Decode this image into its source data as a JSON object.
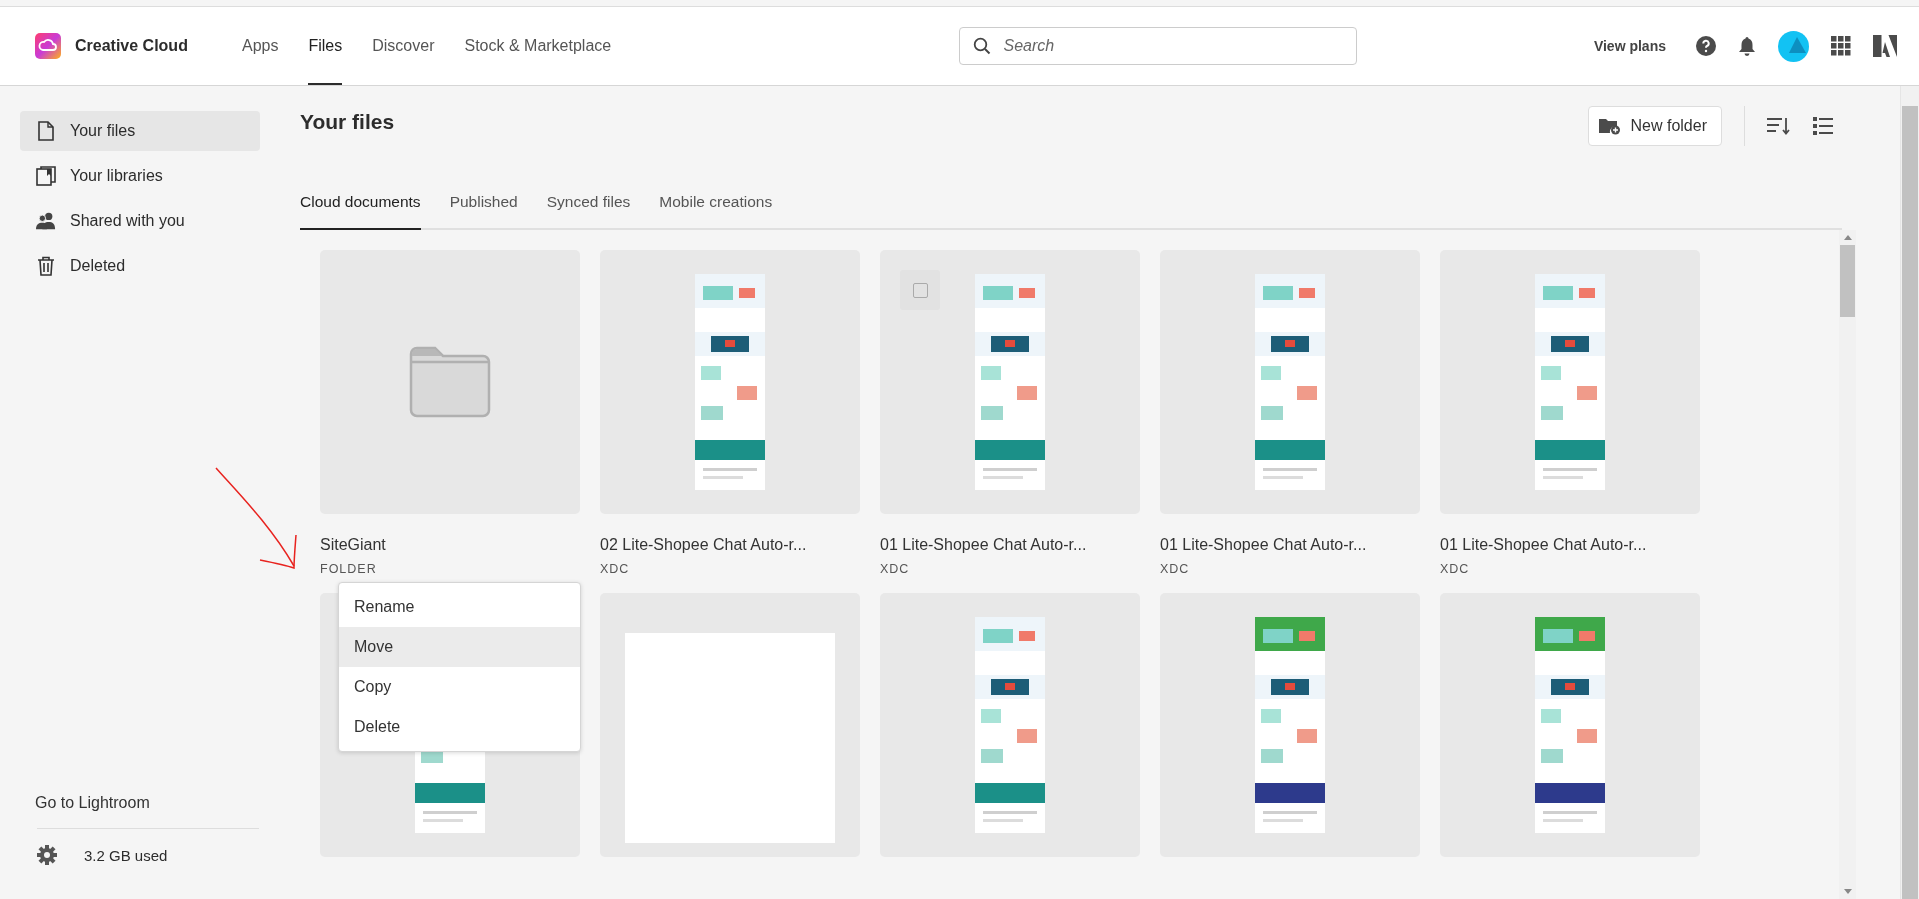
{
  "header": {
    "brand": "Creative Cloud",
    "nav": [
      {
        "label": "Apps",
        "selected": false
      },
      {
        "label": "Files",
        "selected": true
      },
      {
        "label": "Discover",
        "selected": false
      },
      {
        "label": "Stock & Marketplace",
        "selected": false
      }
    ],
    "search": {
      "placeholder": "Search"
    },
    "view_plans": "View plans"
  },
  "sidebar": {
    "items": [
      {
        "label": "Your files",
        "selected": true
      },
      {
        "label": "Your libraries",
        "selected": false
      },
      {
        "label": "Shared with you",
        "selected": false
      },
      {
        "label": "Deleted",
        "selected": false
      }
    ],
    "lightroom_link": "Go to Lightroom",
    "storage": "3.2 GB used"
  },
  "main": {
    "title": "Your files",
    "new_folder": "New folder",
    "tabs": [
      {
        "label": "Cloud documents",
        "selected": true
      },
      {
        "label": "Published",
        "selected": false
      },
      {
        "label": "Synced files",
        "selected": false
      },
      {
        "label": "Mobile creations",
        "selected": false
      }
    ],
    "cards": [
      {
        "kind": "folder",
        "name": "SiteGiant",
        "type": "FOLDER"
      },
      {
        "kind": "document",
        "name": "02 Lite-Shopee Chat Auto-r...",
        "type": "XDC"
      },
      {
        "kind": "document",
        "name": "01 Lite-Shopee Chat Auto-r...",
        "type": "XDC",
        "checkbox": {
          "checked": false
        }
      },
      {
        "kind": "document",
        "name": "01 Lite-Shopee Chat Auto-r...",
        "type": "XDC"
      },
      {
        "kind": "document",
        "name": "01 Lite-Shopee Chat Auto-r...",
        "type": "XDC"
      },
      {
        "kind": "document"
      },
      {
        "kind": "blank"
      },
      {
        "kind": "document"
      },
      {
        "kind": "document"
      },
      {
        "kind": "document"
      }
    ],
    "context_menu": [
      {
        "label": "Rename",
        "highlighted": false
      },
      {
        "label": "Move",
        "highlighted": true
      },
      {
        "label": "Copy",
        "highlighted": false
      },
      {
        "label": "Delete",
        "highlighted": false
      }
    ]
  }
}
